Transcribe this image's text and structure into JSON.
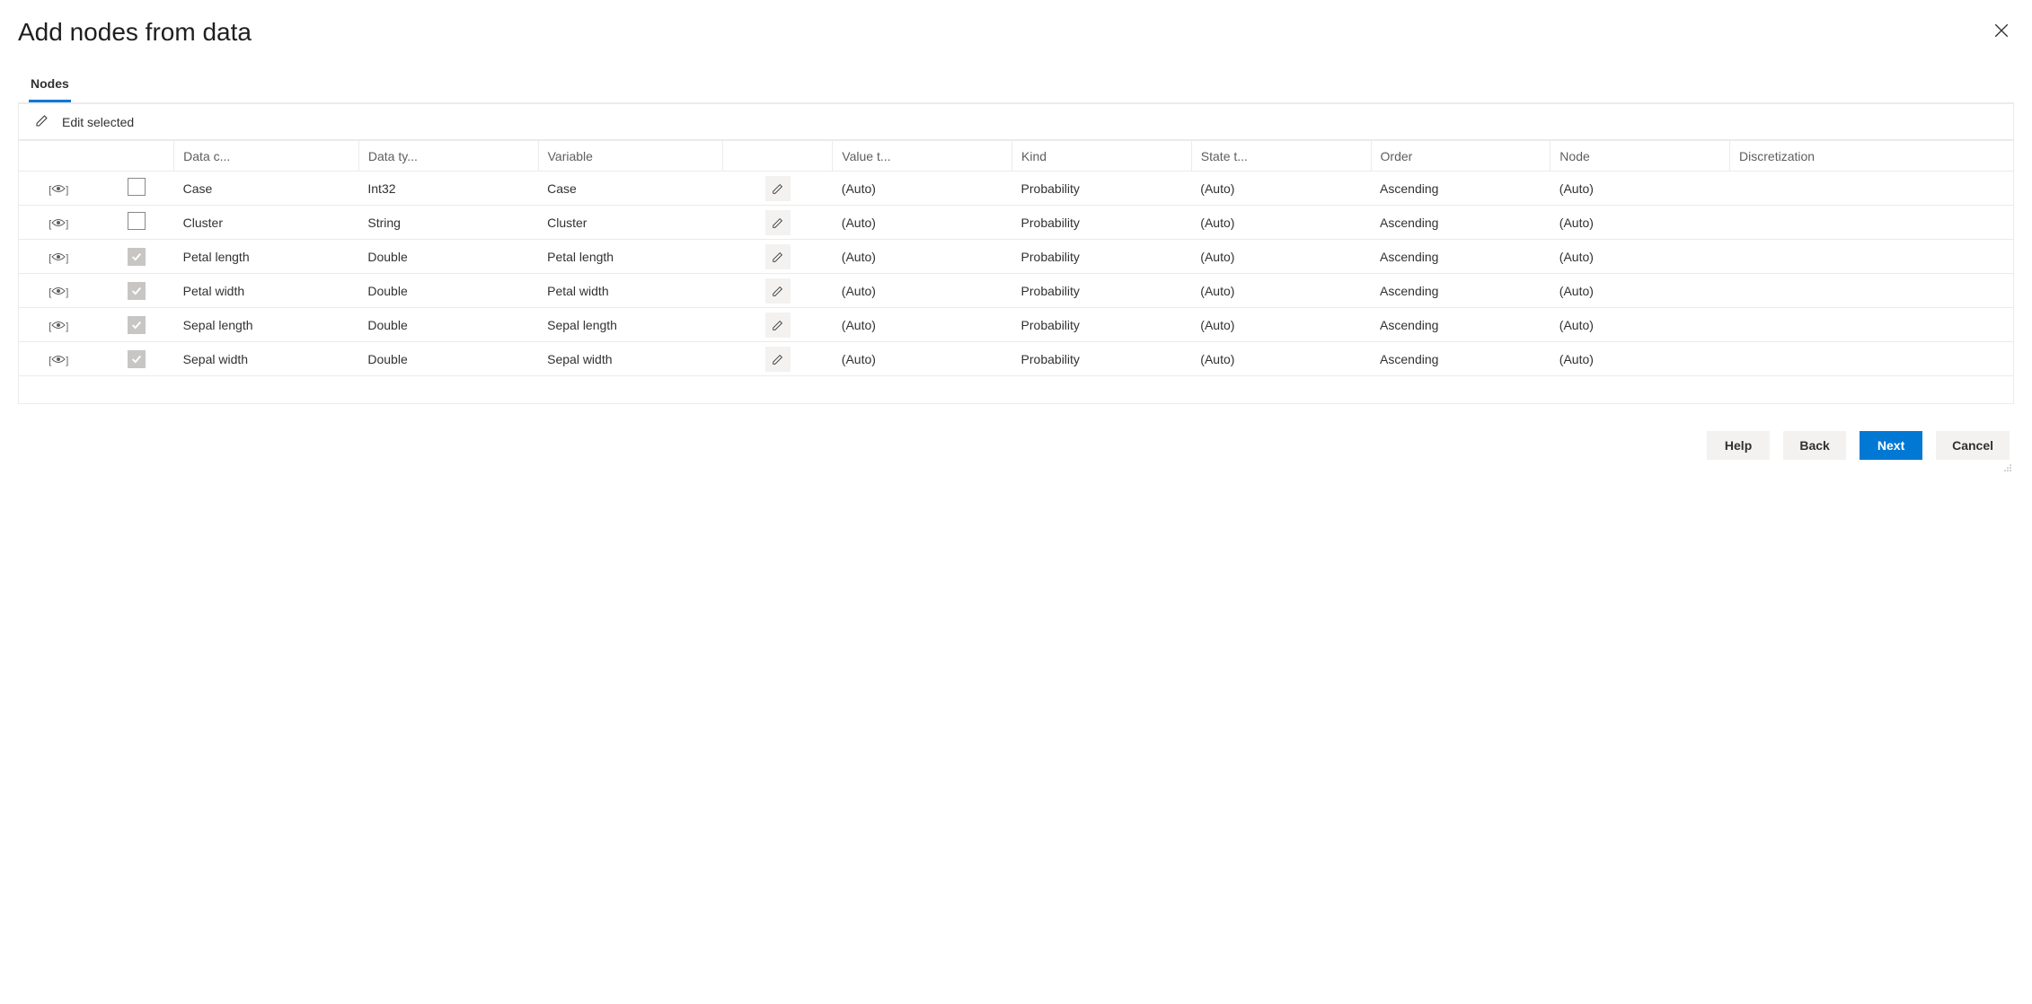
{
  "dialog": {
    "title": "Add nodes from data"
  },
  "tabs": {
    "nodes": "Nodes"
  },
  "toolbar": {
    "edit_selected": "Edit selected"
  },
  "table": {
    "headers": {
      "data_column": "Data c...",
      "data_type": "Data ty...",
      "variable": "Variable",
      "value_type": "Value t...",
      "kind": "Kind",
      "state_type": "State t...",
      "order": "Order",
      "node": "Node",
      "discretization": "Discretization"
    },
    "rows": [
      {
        "checked": false,
        "data_column": "Case",
        "data_type": "Int32",
        "variable": "Case",
        "value_type": "(Auto)",
        "kind": "Probability",
        "state_type": "(Auto)",
        "order": "Ascending",
        "node": "(Auto)",
        "discretization": ""
      },
      {
        "checked": false,
        "data_column": "Cluster",
        "data_type": "String",
        "variable": "Cluster",
        "value_type": "(Auto)",
        "kind": "Probability",
        "state_type": "(Auto)",
        "order": "Ascending",
        "node": "(Auto)",
        "discretization": ""
      },
      {
        "checked": true,
        "data_column": "Petal length",
        "data_type": "Double",
        "variable": "Petal length",
        "value_type": "(Auto)",
        "kind": "Probability",
        "state_type": "(Auto)",
        "order": "Ascending",
        "node": "(Auto)",
        "discretization": ""
      },
      {
        "checked": true,
        "data_column": "Petal width",
        "data_type": "Double",
        "variable": "Petal width",
        "value_type": "(Auto)",
        "kind": "Probability",
        "state_type": "(Auto)",
        "order": "Ascending",
        "node": "(Auto)",
        "discretization": ""
      },
      {
        "checked": true,
        "data_column": "Sepal length",
        "data_type": "Double",
        "variable": "Sepal length",
        "value_type": "(Auto)",
        "kind": "Probability",
        "state_type": "(Auto)",
        "order": "Ascending",
        "node": "(Auto)",
        "discretization": ""
      },
      {
        "checked": true,
        "data_column": "Sepal width",
        "data_type": "Double",
        "variable": "Sepal width",
        "value_type": "(Auto)",
        "kind": "Probability",
        "state_type": "(Auto)",
        "order": "Ascending",
        "node": "(Auto)",
        "discretization": ""
      }
    ]
  },
  "buttons": {
    "help": "Help",
    "back": "Back",
    "next": "Next",
    "cancel": "Cancel"
  }
}
